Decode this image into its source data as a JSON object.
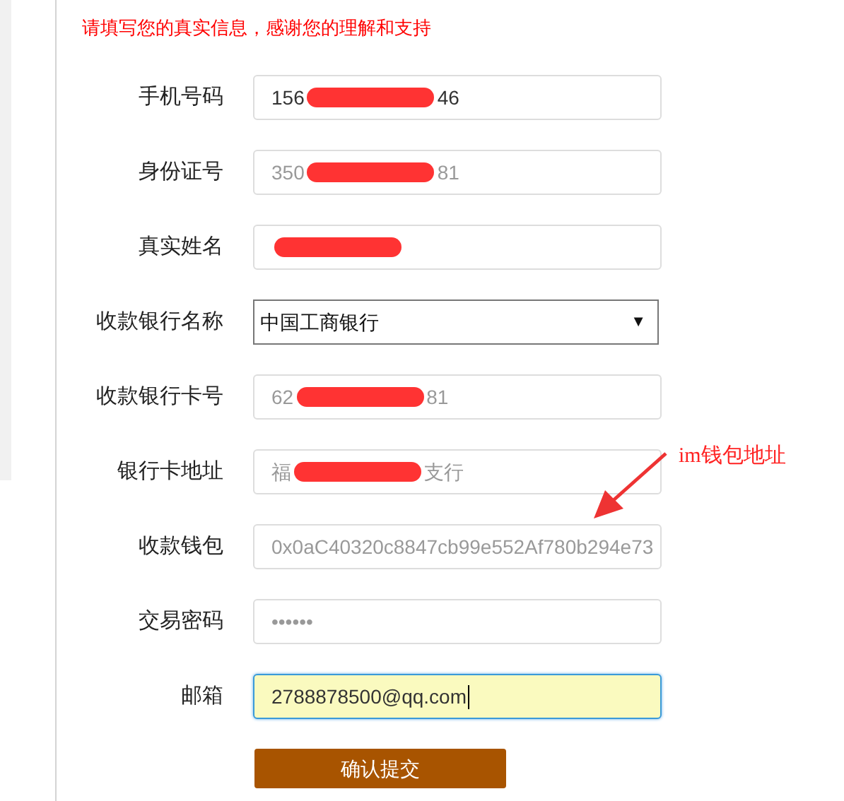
{
  "notice": "请填写您的真实信息，感谢您的理解和支持",
  "fields": [
    {
      "kind": "text",
      "label": "手机号码",
      "value_start": "156",
      "redacted": true,
      "value_end": "46",
      "readonly": false,
      "focused": false
    },
    {
      "kind": "text",
      "label": "身份证号",
      "value_start": "350",
      "redacted": true,
      "value_end": "81",
      "readonly": true,
      "focused": false
    },
    {
      "kind": "text",
      "label": "真实姓名",
      "redacted": true,
      "readonly": true,
      "focused": false
    },
    {
      "kind": "select",
      "label": "收款银行名称",
      "value_start": "中国工商银行",
      "caret": "▼"
    },
    {
      "kind": "text",
      "label": "收款银行卡号",
      "value_start": "62",
      "redacted": true,
      "value_end": "81",
      "readonly": true,
      "focused": false
    },
    {
      "kind": "text",
      "label": "银行卡地址",
      "value_start": "福",
      "redacted": true,
      "value_end": "支行",
      "readonly": true,
      "focused": false
    },
    {
      "kind": "text",
      "label": "收款钱包",
      "value_start": "0x0aC40320c8847cb99e552Af780b294e73",
      "redacted": false,
      "readonly": true,
      "focused": false
    },
    {
      "kind": "text",
      "label": "交易密码",
      "value_start": "••••••",
      "redacted": false,
      "readonly": true,
      "focused": false
    },
    {
      "kind": "text",
      "label": "邮箱",
      "value_start": "2788878500@qq.com",
      "redacted": false,
      "readonly": false,
      "focused": true
    }
  ],
  "submit": "确认提交",
  "annotation": {
    "text": "im钱包地址"
  }
}
